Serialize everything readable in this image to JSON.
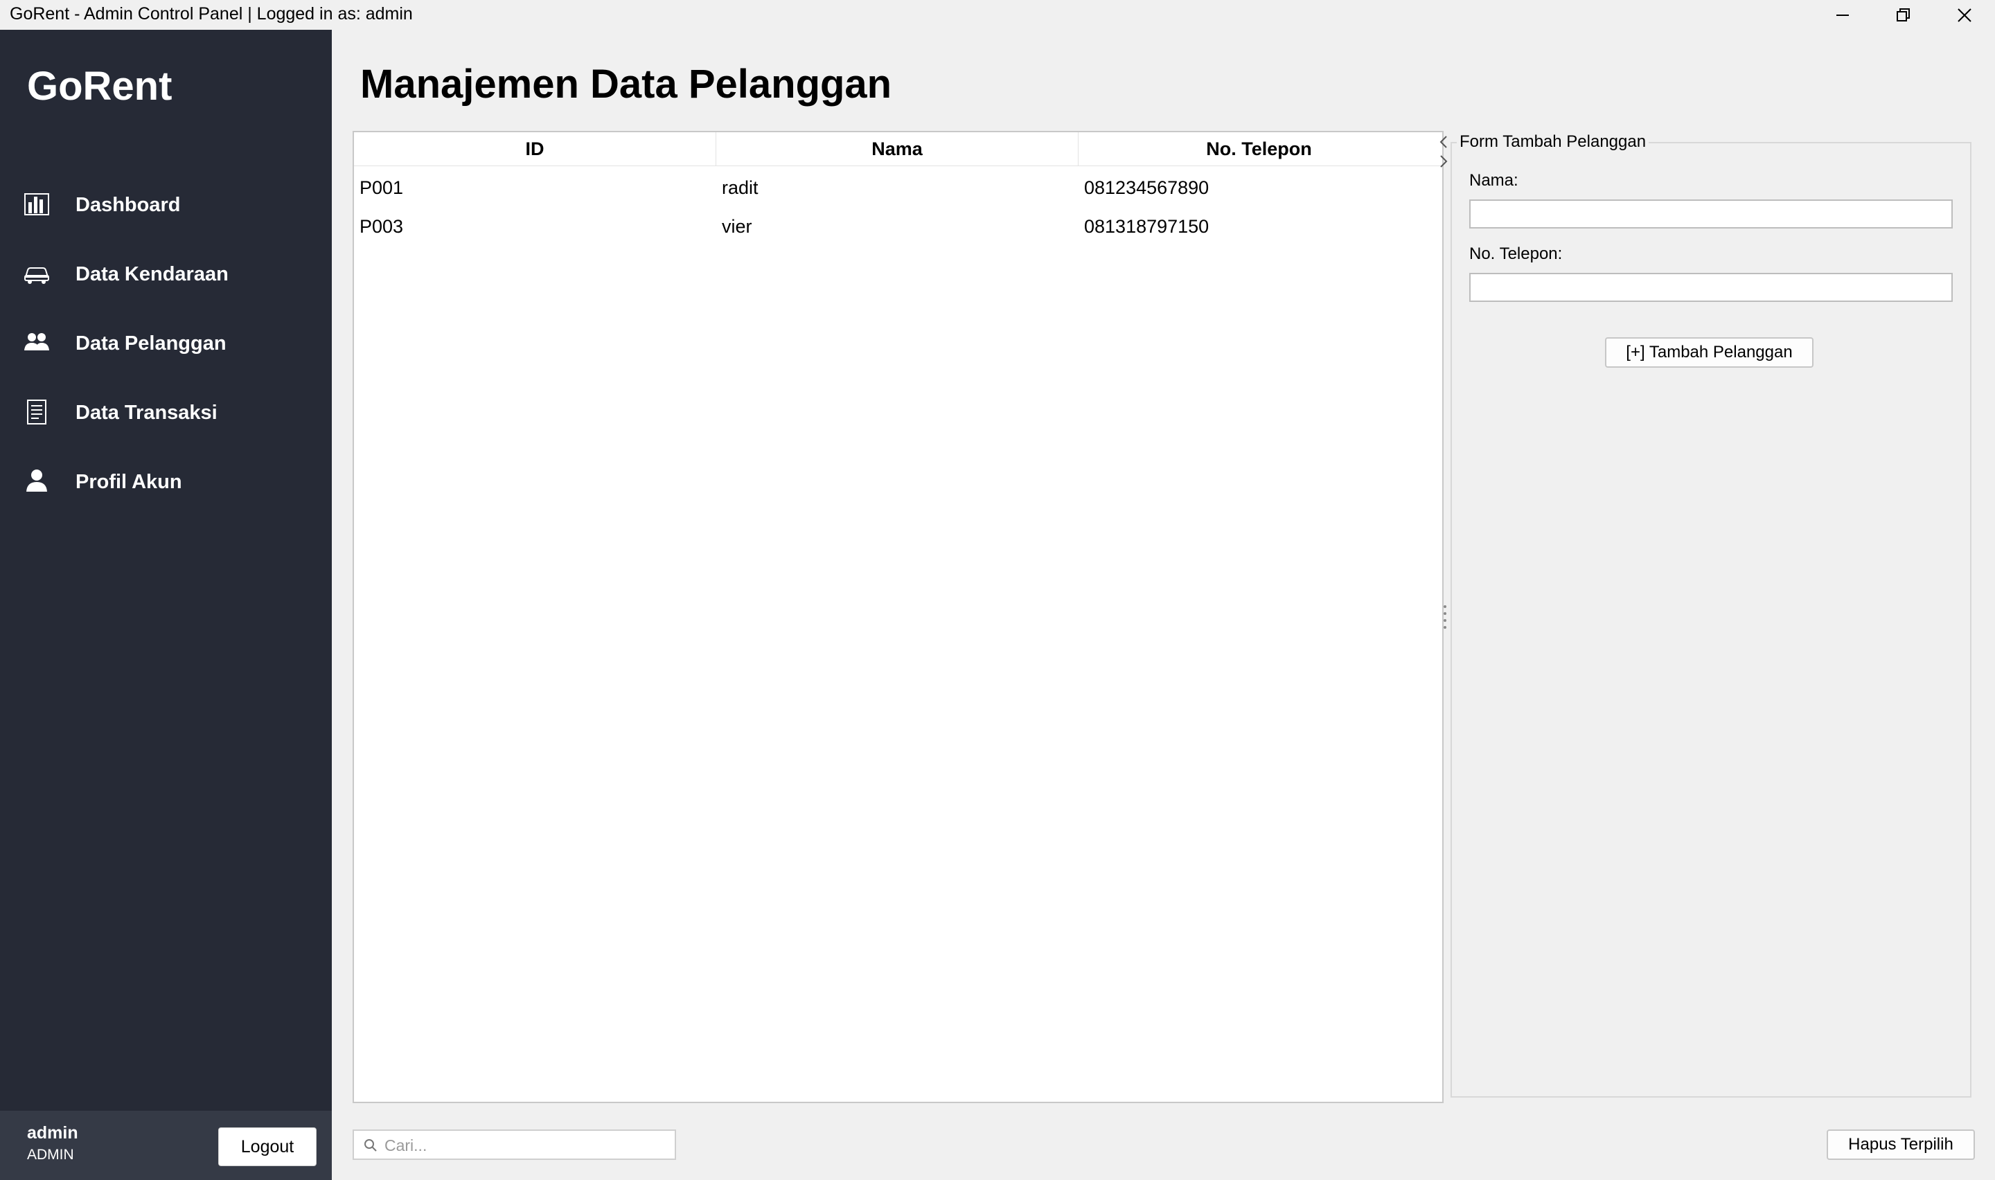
{
  "window": {
    "title": "GoRent - Admin Control Panel | Logged in as: admin"
  },
  "sidebar": {
    "brand": "GoRent",
    "items": [
      {
        "label": "Dashboard",
        "icon": "chart-icon"
      },
      {
        "label": "Data Kendaraan",
        "icon": "car-icon"
      },
      {
        "label": "Data Pelanggan",
        "icon": "users-icon"
      },
      {
        "label": "Data Transaksi",
        "icon": "document-icon"
      },
      {
        "label": "Profil Akun",
        "icon": "user-icon"
      }
    ],
    "user": {
      "name": "admin",
      "role": "ADMIN",
      "logout_label": "Logout"
    }
  },
  "main": {
    "title": "Manajemen Data Pelanggan",
    "table": {
      "columns": [
        "ID",
        "Nama",
        "No. Telepon"
      ],
      "rows": [
        [
          "P001",
          "radit",
          "081234567890"
        ],
        [
          "P003",
          "vier",
          "081318797150"
        ]
      ]
    },
    "form": {
      "legend": "Form Tambah Pelanggan",
      "name_label": "Nama:",
      "name_value": "",
      "phone_label": "No. Telepon:",
      "phone_value": "",
      "submit_label": "[+] Tambah Pelanggan"
    },
    "search": {
      "placeholder": "Cari..."
    },
    "delete_label": "Hapus Terpilih"
  },
  "colors": {
    "sidebar_bg": "#262a36",
    "user_box_bg": "#353a46",
    "window_bg": "#f0f0f0"
  }
}
